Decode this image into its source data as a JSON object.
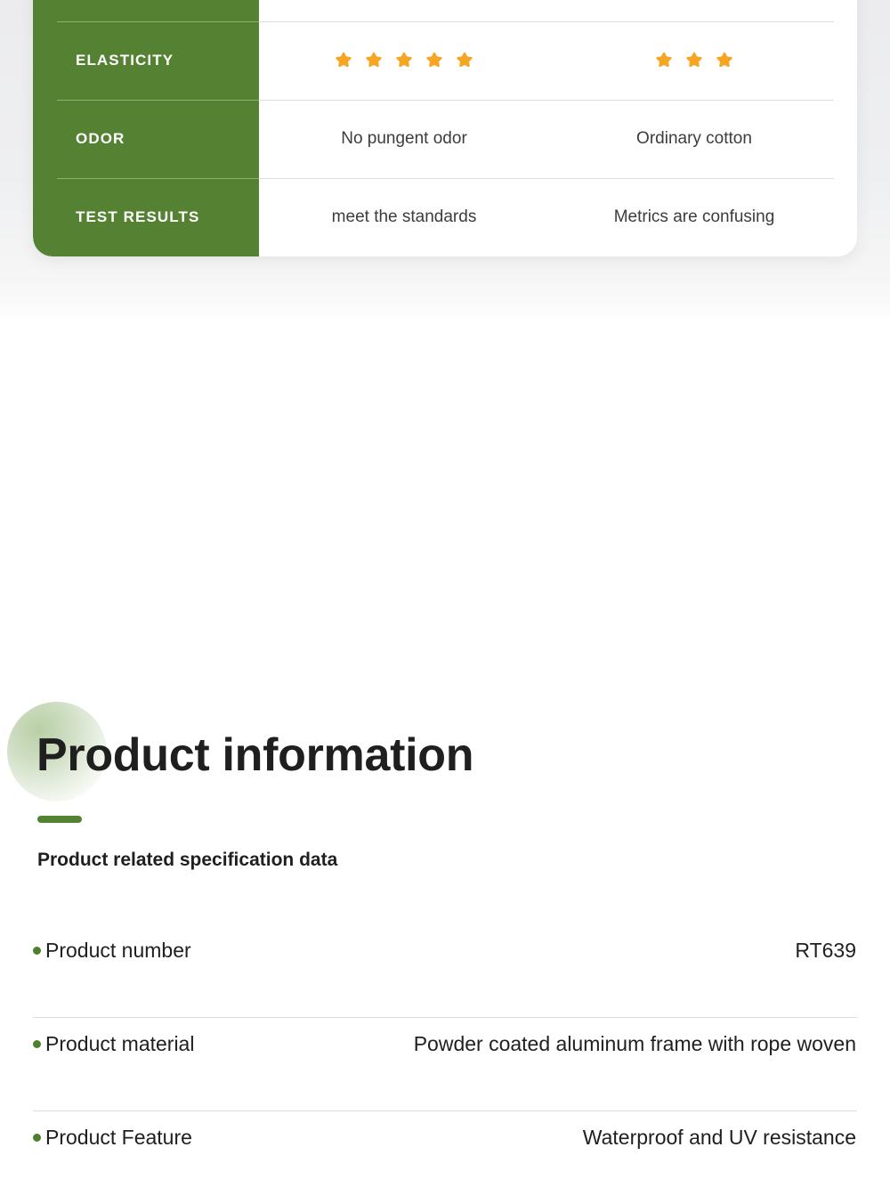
{
  "comparison_card": {
    "rows": [
      {
        "label": "",
        "our_product": "",
        "other_product": "",
        "type": "blank"
      },
      {
        "label": "ELASTICITY",
        "type": "stars",
        "our_product_stars": 5,
        "other_product_stars": 3
      },
      {
        "label": "ODOR",
        "type": "text",
        "our_product": "No pungent odor",
        "other_product": "Ordinary cotton"
      },
      {
        "label": "TEST RESULTS",
        "type": "text",
        "our_product": "meet the standards",
        "other_product": "Metrics are confusing"
      }
    ],
    "colors": {
      "label_column_bg": "#558133",
      "star_fill": "#F5A623",
      "card_bg": "#FFFFFF",
      "divider_grey": "#DDDDDD",
      "divider_green": "#8FAE73"
    },
    "icons": {
      "star": "star-icon"
    }
  },
  "product_info": {
    "title": "Product information",
    "subtitle": "Product related specification data",
    "accent_color": "#558133",
    "bullet_color": "#4E7F2E",
    "specs": [
      {
        "key": "Product number",
        "value": "RT639"
      },
      {
        "key": "Product material",
        "value": "Powder coated aluminum frame with rope woven"
      },
      {
        "key": "Product Feature",
        "value": "Waterproof and UV resistance"
      }
    ]
  }
}
